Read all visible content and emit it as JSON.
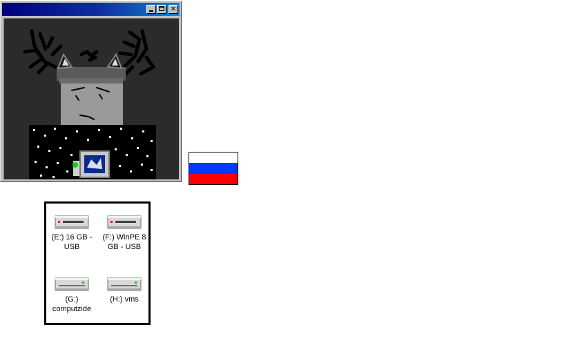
{
  "window": {
    "title": "",
    "buttons": {
      "minimize": "minimize",
      "maximize": "maximize",
      "close": "close"
    },
    "image_subject": "drawing of a grey character with antlers, cat ears and a starry body holding a computer"
  },
  "flag": {
    "colors": [
      "#ffffff",
      "#0039ff",
      "#ff0000"
    ]
  },
  "drives": [
    {
      "label": "(E:) 16 GB - USB",
      "icon": "usb-drive-icon",
      "led": "#ff0000"
    },
    {
      "label": "(F:) WinPE 8 GB - USB",
      "icon": "usb-drive-icon",
      "led": "#ff0000"
    },
    {
      "label": "(G:) computzide",
      "icon": "hard-drive-icon",
      "led": "#00cc00"
    },
    {
      "label": "(H:) vms",
      "icon": "hard-drive-icon",
      "led": "#00cc00"
    }
  ],
  "colors": {
    "title_bar_start": "#00007b",
    "title_bar_end": "#1084d0",
    "canvas_bg": "#2b2b2b"
  }
}
